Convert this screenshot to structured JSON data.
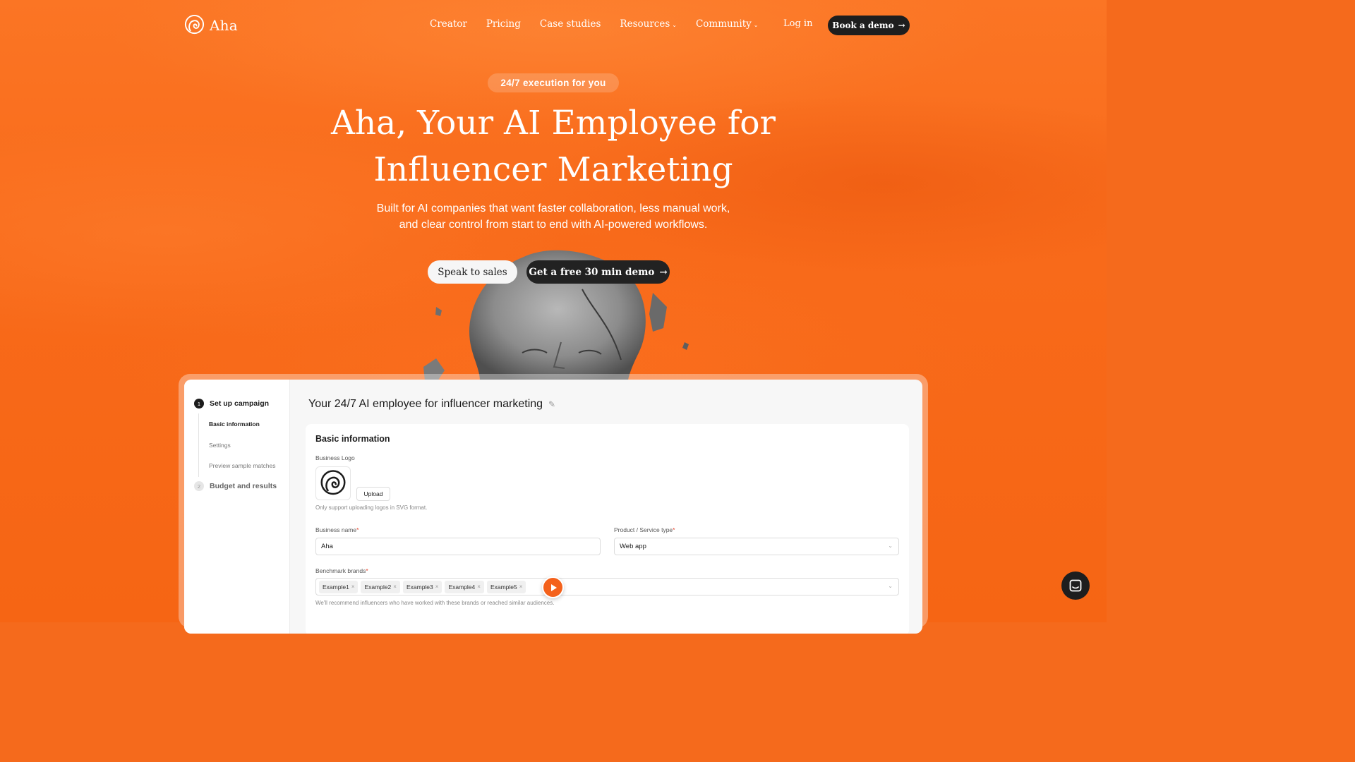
{
  "brand": {
    "name": "Aha"
  },
  "nav": {
    "links": [
      {
        "label": "Creator"
      },
      {
        "label": "Pricing"
      },
      {
        "label": "Case studies"
      },
      {
        "label": "Resources"
      },
      {
        "label": "Community"
      }
    ],
    "login": "Log in",
    "cta": "Book a demo"
  },
  "hero": {
    "pill": "24/7 execution for you",
    "title_line1": "Aha, Your AI Employee for",
    "title_line2": "Influencer Marketing",
    "subtitle_line1": "Built for AI companies that want faster collaboration, less manual work,",
    "subtitle_line2": "and clear control from start to end with AI-powered workflows.",
    "btn_secondary": "Speak to sales",
    "btn_primary": "Get a free 30 min demo"
  },
  "app": {
    "steps": [
      {
        "num": "1",
        "label": "Set up campaign"
      },
      {
        "num": "2",
        "label": "Budget and results"
      }
    ],
    "substeps": [
      "Basic information",
      "Settings",
      "Preview sample matches"
    ],
    "title": "Your 24/7 AI employee for influencer marketing",
    "panel_title": "Basic information",
    "logo_label": "Business Logo",
    "upload": "Upload",
    "logo_hint": "Only support uploading logos in SVG format.",
    "business_name_label": "Business name",
    "business_name_value": "Aha",
    "product_type_label": "Product / Service type",
    "product_type_value": "Web app",
    "benchmark_label": "Benchmark brands",
    "benchmark_tags": [
      "Example1",
      "Example2",
      "Example3",
      "Example4",
      "Example5"
    ],
    "benchmark_hint": "We'll recommend influencers who have worked with these brands or reached similar audiences.",
    "required_mark": "*"
  },
  "colors": {
    "accent": "#f56a1c",
    "dark": "#1e1e1e"
  }
}
